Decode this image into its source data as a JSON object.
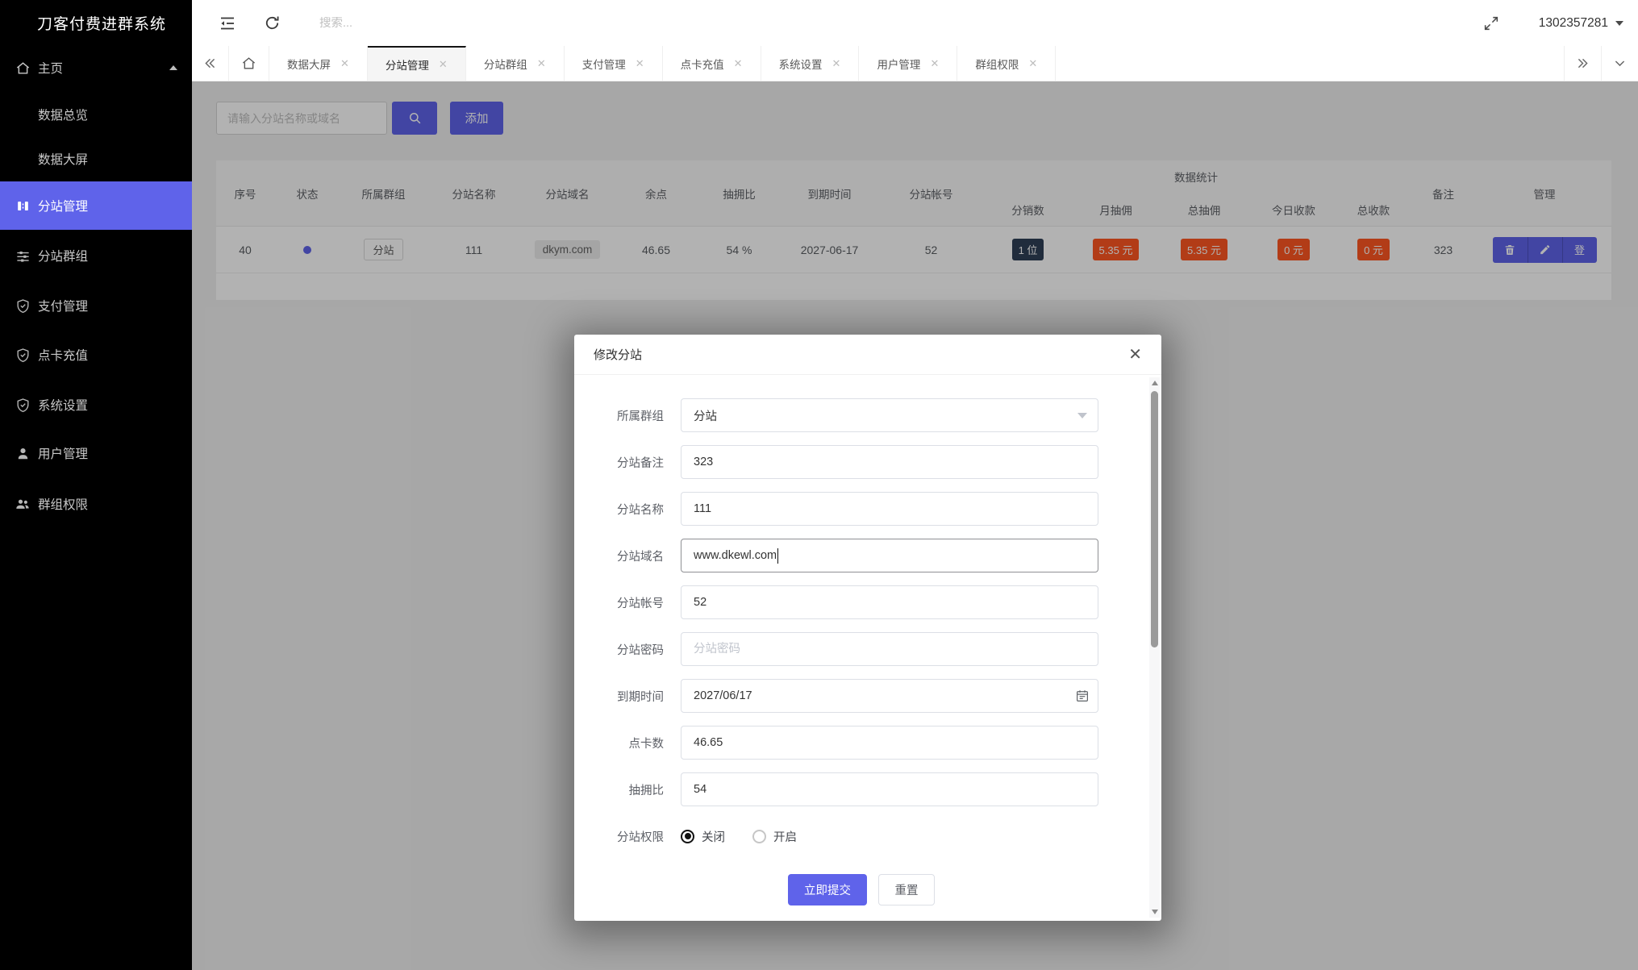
{
  "app": {
    "title": "刀客付费进群系统"
  },
  "topbar": {
    "search_placeholder": "搜索...",
    "username": "1302357281"
  },
  "sidebar": {
    "items": [
      {
        "label": "主页"
      },
      {
        "label": "数据总览"
      },
      {
        "label": "数据大屏"
      },
      {
        "label": "分站管理",
        "active": true
      },
      {
        "label": "分站群组"
      },
      {
        "label": "支付管理"
      },
      {
        "label": "点卡充值"
      },
      {
        "label": "系统设置"
      },
      {
        "label": "用户管理"
      },
      {
        "label": "群组权限"
      }
    ]
  },
  "tabs": {
    "items": [
      {
        "label": "数据大屏"
      },
      {
        "label": "分站管理",
        "active": true
      },
      {
        "label": "分站群组"
      },
      {
        "label": "支付管理"
      },
      {
        "label": "点卡充值"
      },
      {
        "label": "系统设置"
      },
      {
        "label": "用户管理"
      },
      {
        "label": "群组权限"
      }
    ]
  },
  "toolbar": {
    "search_placeholder": "请输入分站名称或域名",
    "add_label": "添加"
  },
  "table": {
    "group_header": "数据统计",
    "columns": [
      "序号",
      "状态",
      "所属群组",
      "分站名称",
      "分站域名",
      "余点",
      "抽拥比",
      "到期时间",
      "分站帐号",
      "分销数",
      "月抽佣",
      "总抽佣",
      "今日收款",
      "总收款",
      "备注",
      "管理"
    ],
    "row": {
      "seq": "40",
      "group_tag": "分站",
      "name": "111",
      "domain": "dkym.com",
      "balance": "46.65",
      "commission_rate": "54 %",
      "expire": "2027-06-17",
      "account": "52",
      "distributors": "1 位",
      "month_commission": "5.35 元",
      "total_commission": "5.35 元",
      "today_income": "0 元",
      "total_income": "0 元",
      "remark": "323",
      "login_label": "登"
    }
  },
  "modal": {
    "title": "修改分站",
    "fields": [
      {
        "label": "所属群组",
        "value": "分站"
      },
      {
        "label": "分站备注",
        "value": "323"
      },
      {
        "label": "分站名称",
        "value": "111"
      },
      {
        "label": "分站域名",
        "value": "www.dkewl.com"
      },
      {
        "label": "分站帐号",
        "value": "52"
      },
      {
        "label": "分站密码",
        "placeholder": "分站密码"
      },
      {
        "label": "到期时间",
        "value": "2027/06/17"
      },
      {
        "label": "点卡数",
        "value": "46.65"
      },
      {
        "label": "抽拥比",
        "value": "54"
      },
      {
        "label": "分站权限",
        "options": [
          "关闭",
          "开启"
        ],
        "selected": "关闭"
      }
    ],
    "submit_label": "立即提交",
    "reset_label": "重置"
  },
  "colors": {
    "accent": "#5f63ea",
    "danger": "#ff5722",
    "navy": "#2f4056"
  }
}
